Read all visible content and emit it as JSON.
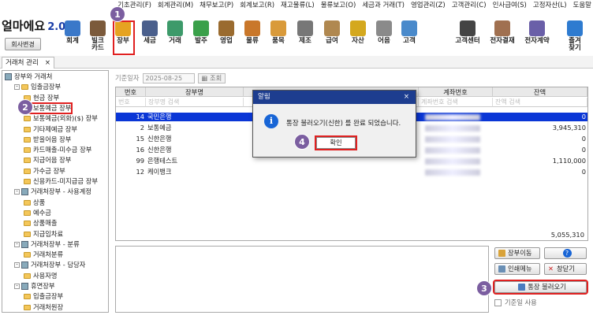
{
  "menu": [
    "기초관리(F)",
    "회계관리(M)",
    "채무보고(P)",
    "회계보고(R)",
    "재고물류(L)",
    "물류보고(O)",
    "세금과 거래(T)",
    "영업관리(Z)",
    "고객관리(C)",
    "인사급여(S)",
    "고정자산(L)",
    "도움말"
  ],
  "app": {
    "logo": "얼마에요",
    "version": "2.0",
    "company_btn": "회사변경"
  },
  "toolbar": [
    {
      "label": "회계",
      "color": "#3a78c9"
    },
    {
      "label": "빌크\n카드",
      "color": "#7b5a3b"
    },
    {
      "label": "장부",
      "color": "#e6a321"
    },
    {
      "label": "세금",
      "color": "#4a5f8c"
    },
    {
      "label": "거래",
      "color": "#3d9a6a"
    },
    {
      "label": "발주",
      "color": "#3aa04a"
    },
    {
      "label": "영업",
      "color": "#9a6b2f"
    },
    {
      "label": "물류",
      "color": "#c9772a"
    },
    {
      "label": "품목",
      "color": "#d99a3a"
    },
    {
      "label": "제조",
      "color": "#777777"
    },
    {
      "label": "급여",
      "color": "#b08850"
    },
    {
      "label": "자산",
      "color": "#d4a81e"
    },
    {
      "label": "어음",
      "color": "#8a8a8a"
    },
    {
      "label": "고객",
      "color": "#4a8acb"
    }
  ],
  "toolbar_right": [
    {
      "label": "고객센터",
      "color": "#444444"
    },
    {
      "label": "전자결재",
      "color": "#a07050"
    },
    {
      "label": "전자계약",
      "color": "#6a5fa8"
    },
    {
      "label": "즐겨\n찾기",
      "color": "#2e7bd0"
    }
  ],
  "tab": {
    "label": "거래처 관리",
    "close": "×"
  },
  "tree": [
    {
      "label": "장부와 거래처",
      "level": 0,
      "icon": "book"
    },
    {
      "label": "입출금장부",
      "level": 1,
      "icon": "folder",
      "pm": "-"
    },
    {
      "label": "현금 장부",
      "level": 2,
      "icon": "folder"
    },
    {
      "label": "보통예금 장부",
      "level": 2,
      "icon": "folder",
      "selected": true
    },
    {
      "label": "보통예금(외화)($) 장부",
      "level": 2,
      "icon": "folder"
    },
    {
      "label": "기타제예금 장부",
      "level": 2,
      "icon": "folder"
    },
    {
      "label": "받을어음 장부",
      "level": 2,
      "icon": "folder"
    },
    {
      "label": "카드매출-미수금 장부",
      "level": 2,
      "icon": "folder"
    },
    {
      "label": "지급어음 장부",
      "level": 2,
      "icon": "folder"
    },
    {
      "label": "가수금 장부",
      "level": 2,
      "icon": "folder"
    },
    {
      "label": "신용카드-미지급금 장부",
      "level": 2,
      "icon": "folder"
    },
    {
      "label": "거래처장부 - 사용계정",
      "level": 1,
      "icon": "book",
      "pm": "-"
    },
    {
      "label": "상품",
      "level": 2,
      "icon": "folder"
    },
    {
      "label": "예수금",
      "level": 2,
      "icon": "folder"
    },
    {
      "label": "상품매출",
      "level": 2,
      "icon": "folder"
    },
    {
      "label": "지급임차료",
      "level": 2,
      "icon": "folder"
    },
    {
      "label": "거래처장부 - 분류",
      "level": 1,
      "icon": "book",
      "pm": "-"
    },
    {
      "label": "거래처분류",
      "level": 2,
      "icon": "folder"
    },
    {
      "label": "거래처장부 - 담당자",
      "level": 1,
      "icon": "book",
      "pm": "-"
    },
    {
      "label": "사용자명",
      "level": 2,
      "icon": "folder"
    },
    {
      "label": "휴면장부",
      "level": 1,
      "icon": "book",
      "pm": "-"
    },
    {
      "label": "입출금장부",
      "level": 2,
      "icon": "folder"
    },
    {
      "label": "거래처원장",
      "level": 2,
      "icon": "folder"
    }
  ],
  "filter": {
    "label": "기준일자",
    "date": "2025-08-25",
    "search": "조회"
  },
  "grid": {
    "headers": [
      "번호",
      "장부명",
      "계좌번호",
      "잔액"
    ],
    "filters": [
      "번호",
      "장부명 검색",
      "계좌번호 검색",
      "잔액 검색"
    ],
    "rows": [
      {
        "no": "14",
        "name": "국민은행",
        "balance": "0",
        "selected": true
      },
      {
        "no": "2",
        "name": "보통예금",
        "balance": "3,945,310"
      },
      {
        "no": "15",
        "name": "신한은행",
        "balance": "0"
      },
      {
        "no": "16",
        "name": "신한은행",
        "balance": "0"
      },
      {
        "no": "99",
        "name": "은행테스트",
        "balance": "1,110,000"
      },
      {
        "no": "12",
        "name": "케이뱅크",
        "balance": "0"
      }
    ],
    "total": "5,055,310"
  },
  "right_buttons": {
    "move": "장부이동",
    "help": "?",
    "print": "인쇄메뉴",
    "close": "창닫기",
    "import": "통장 불러오기",
    "baseday": "기준일 사용"
  },
  "dialog": {
    "title": "알림",
    "close": "×",
    "icon": "i",
    "message": "통장 불러오기(신한) 를 완료 되었습니다.",
    "ok": "확인"
  },
  "badges": [
    "1",
    "2",
    "3",
    "4"
  ]
}
